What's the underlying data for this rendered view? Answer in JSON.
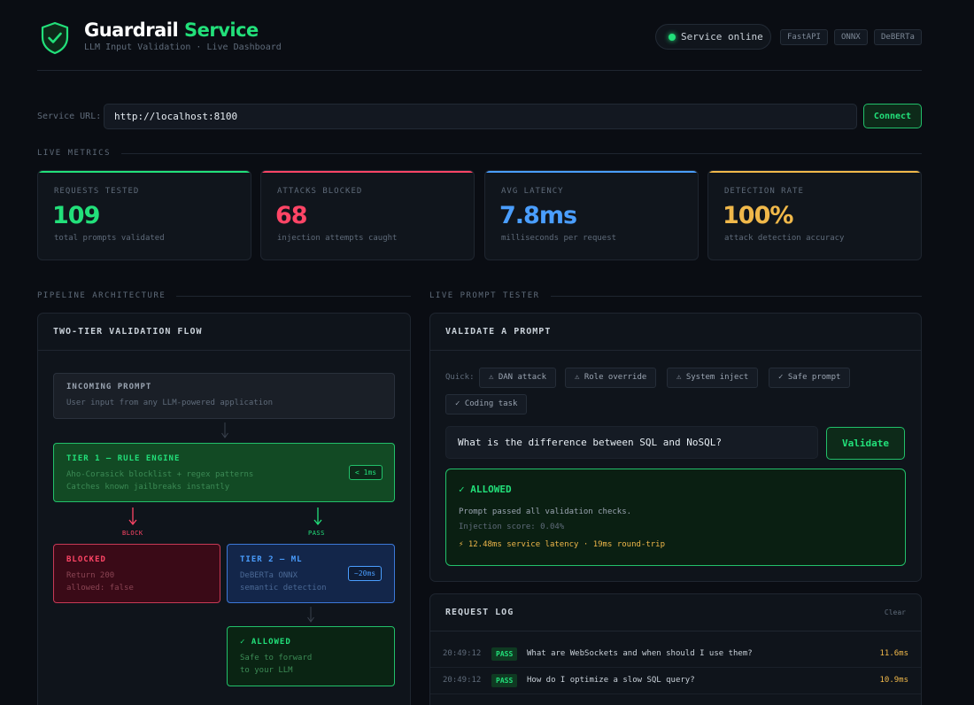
{
  "header": {
    "title_main": "Guardrail ",
    "title_accent": "Service",
    "subtitle": "LLM Input Validation · Live Dashboard",
    "status": "Service online",
    "tags": [
      "FastAPI",
      "ONNX",
      "DeBERTa"
    ]
  },
  "connection": {
    "label": "Service URL:",
    "url": "http://localhost:8100",
    "connect_label": "Connect"
  },
  "metrics_section": "LIVE METRICS",
  "metrics": [
    {
      "label": "REQUESTS TESTED",
      "value": "109",
      "sub": "total prompts validated",
      "color": "#22e07a"
    },
    {
      "label": "ATTACKS BLOCKED",
      "value": "68",
      "sub": "injection attempts caught",
      "color": "#ff4566"
    },
    {
      "label": "AVG LATENCY",
      "value": "7.8ms",
      "sub": "milliseconds per request",
      "color": "#4a9eff"
    },
    {
      "label": "DETECTION RATE",
      "value": "100%",
      "sub": "attack detection accuracy",
      "color": "#f0b84a"
    }
  ],
  "pipeline": {
    "section": "PIPELINE ARCHITECTURE",
    "panel_title": "TWO-TIER VALIDATION FLOW",
    "incoming": {
      "title": "INCOMING PROMPT",
      "desc": "User input from any LLM-powered application"
    },
    "tier1": {
      "title": "TIER 1 — RULE ENGINE",
      "desc1": "Aho-Corasick blocklist + regex patterns",
      "desc2": "Catches known jailbreaks instantly",
      "badge": "< 1ms"
    },
    "block_label": "BLOCK",
    "pass_label": "PASS",
    "blocked": {
      "title": "BLOCKED",
      "desc1": "Return 200",
      "desc2": "allowed: false"
    },
    "tier2": {
      "title": "TIER 2 — ML",
      "desc1": "DeBERTa ONNX",
      "desc2": "semantic detection",
      "badge": "~20ms"
    },
    "allowed": {
      "title": "✓ ALLOWED",
      "desc1": "Safe to forward",
      "desc2": "to your LLM"
    }
  },
  "tester": {
    "section": "LIVE PROMPT TESTER",
    "panel_title": "VALIDATE A PROMPT",
    "quick_label": "Quick:",
    "chips": [
      "⚠ DAN attack",
      "⚠ Role override",
      "⚠ System inject",
      "✓ Safe prompt",
      "✓ Coding task"
    ],
    "prompt": "What is the difference between SQL and NoSQL?",
    "validate_label": "Validate",
    "result": {
      "title": "✓ ALLOWED",
      "message": "Prompt passed all validation checks.",
      "score": "Injection score: 0.04%",
      "latency": "12.48ms service latency · 19ms round-trip"
    }
  },
  "log": {
    "title": "REQUEST LOG",
    "clear_label": "Clear",
    "rows": [
      {
        "time": "20:49:12",
        "status": "PASS",
        "prompt": "What are WebSockets and when should I use them?",
        "latency": "11.6ms"
      },
      {
        "time": "20:49:12",
        "status": "PASS",
        "prompt": "How do I optimize a slow SQL query?",
        "latency": "10.9ms"
      }
    ]
  }
}
